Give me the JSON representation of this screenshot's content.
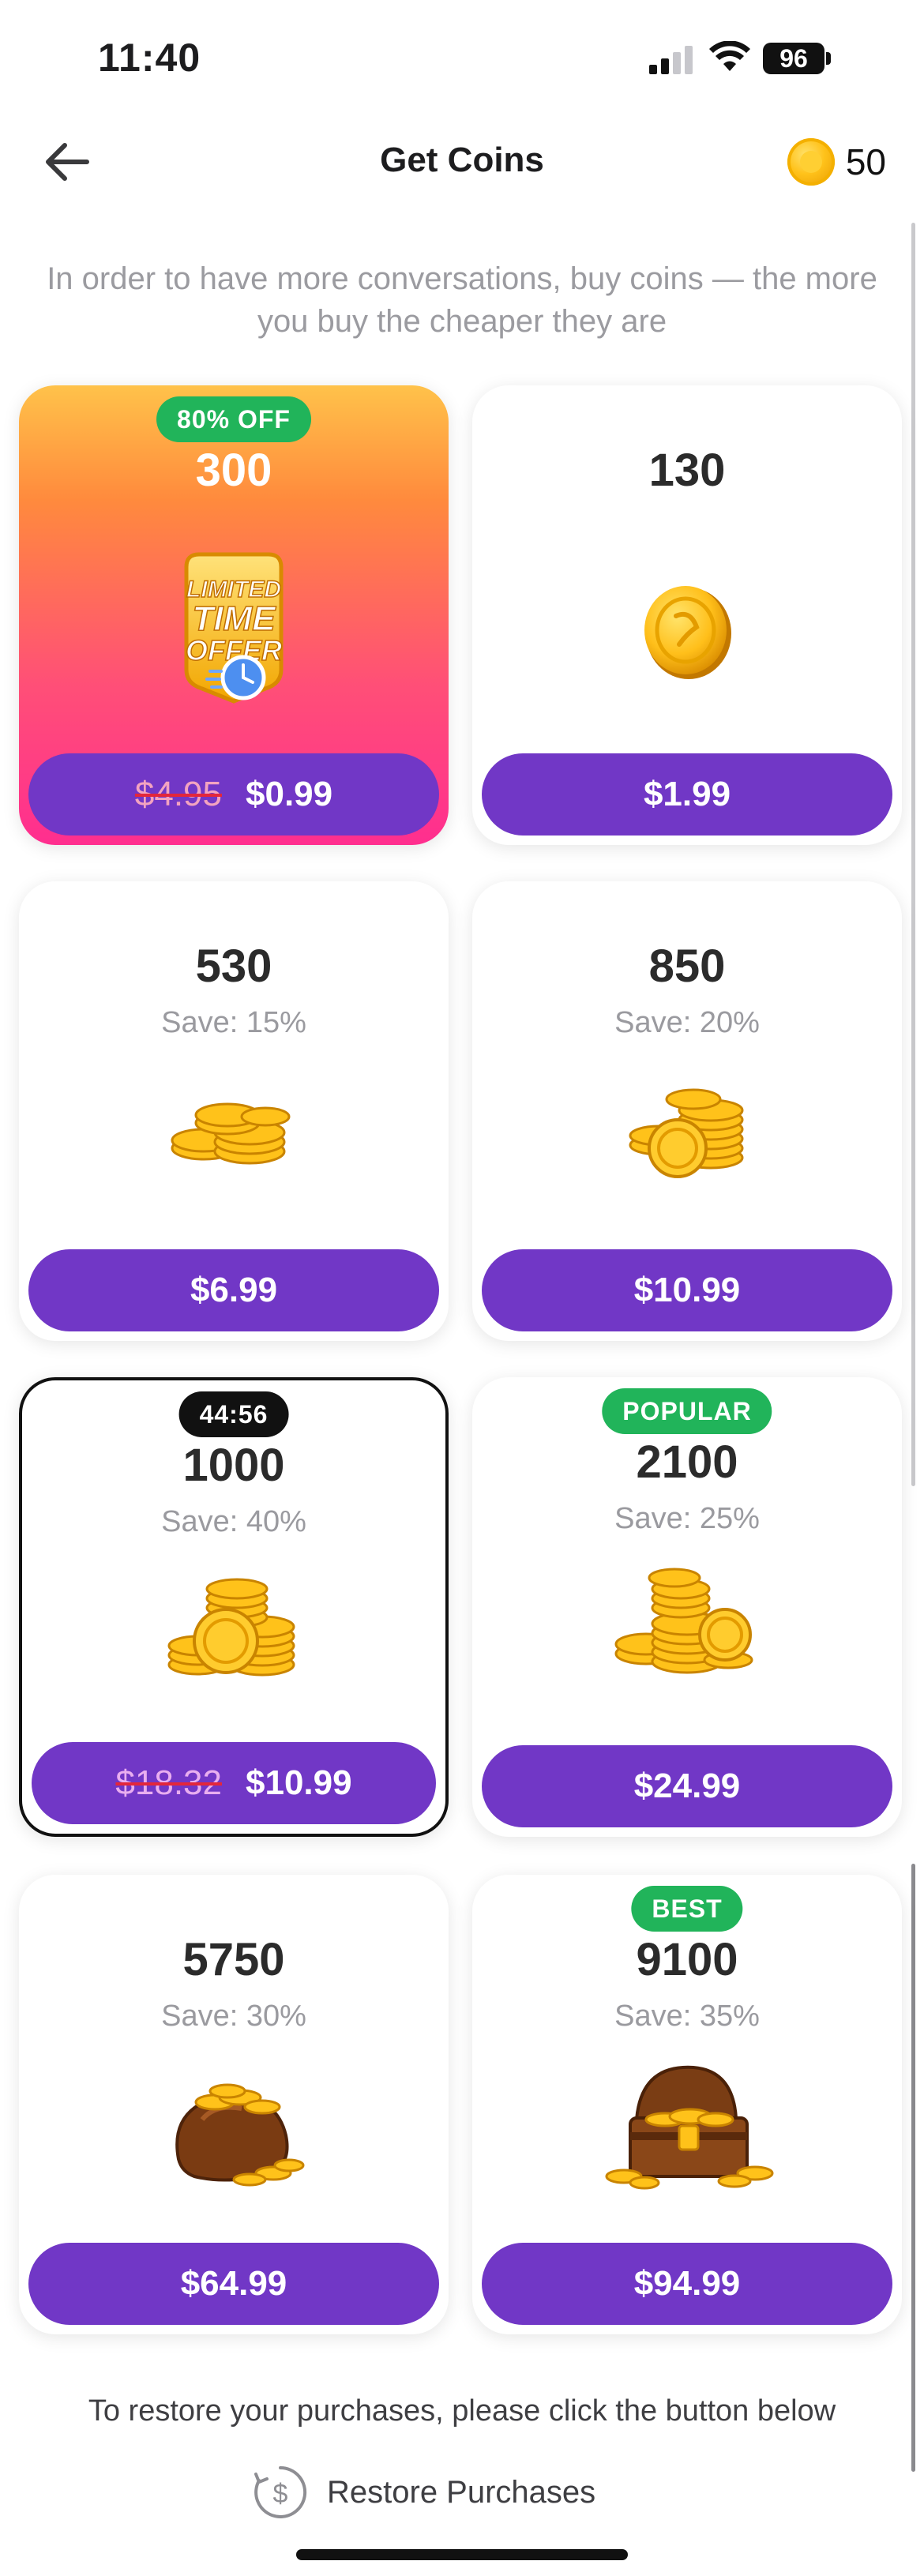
{
  "status_bar": {
    "time": "11:40",
    "battery": "96"
  },
  "header": {
    "title": "Get Coins",
    "balance": "50"
  },
  "intro_text": "In order to have more conversations, buy coins — the more you buy the cheaper they are",
  "packages": [
    {
      "badge": "80% OFF",
      "amount": "300",
      "save": "",
      "old_price": "$4.95",
      "price": "$0.99",
      "art": "limited-time-offer"
    },
    {
      "badge": "",
      "amount": "130",
      "save": "",
      "old_price": "",
      "price": "$1.99",
      "art": "single-coin"
    },
    {
      "badge": "",
      "amount": "530",
      "save": "Save: 15%",
      "old_price": "",
      "price": "$6.99",
      "art": "coin-stack-small"
    },
    {
      "badge": "",
      "amount": "850",
      "save": "Save: 20%",
      "old_price": "",
      "price": "$10.99",
      "art": "coin-stack-medium"
    },
    {
      "badge": "44:56",
      "amount": "1000",
      "save": "Save: 40%",
      "old_price": "$18.32",
      "price": "$10.99",
      "art": "coin-stack-large"
    },
    {
      "badge": "POPULAR",
      "amount": "2100",
      "save": "Save: 25%",
      "old_price": "",
      "price": "$24.99",
      "art": "coin-pile"
    },
    {
      "badge": "",
      "amount": "5750",
      "save": "Save: 30%",
      "old_price": "",
      "price": "$64.99",
      "art": "coin-bag"
    },
    {
      "badge": "BEST",
      "amount": "9100",
      "save": "Save: 35%",
      "old_price": "",
      "price": "$94.99",
      "art": "treasure-chest"
    }
  ],
  "offer_art_text": {
    "line1": "LIMITED",
    "line2": "TIME",
    "line3": "OFFER"
  },
  "restore": {
    "note": "To restore your purchases, please click the button below",
    "label": "Restore Purchases"
  },
  "colors": {
    "accent": "#7137c6",
    "badge_green": "#21b45a",
    "promo_gradient_top": "#ffc24a",
    "promo_gradient_bottom": "#ff2e8f"
  }
}
